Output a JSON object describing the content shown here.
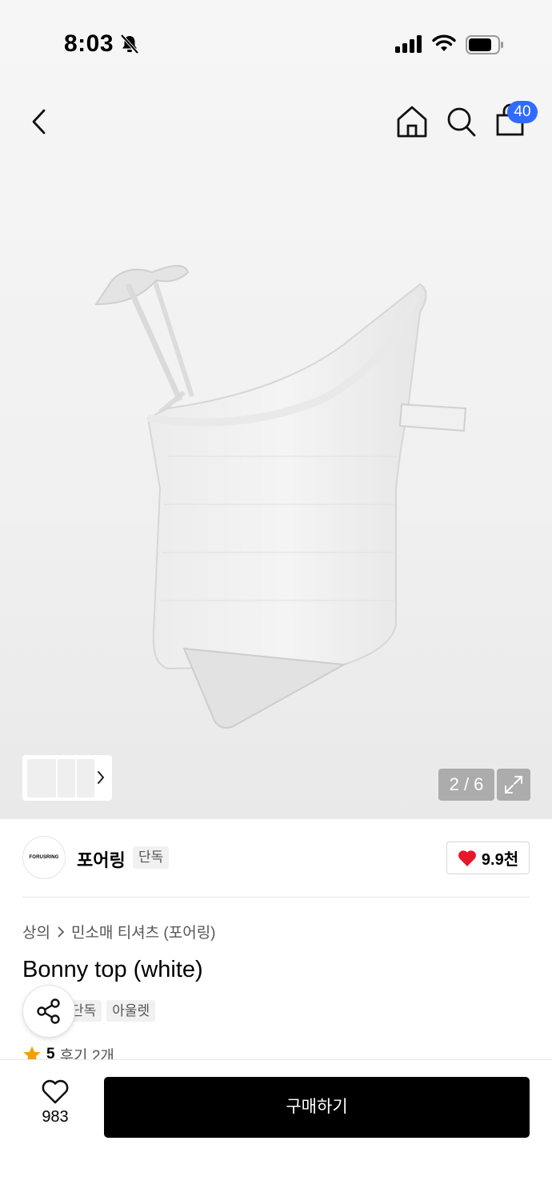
{
  "status_bar": {
    "time": "8:03"
  },
  "nav": {
    "cart_count": "40"
  },
  "gallery": {
    "counter": "2 / 6"
  },
  "brand": {
    "logo_text": "FORUSRING",
    "name": "포어링",
    "tag": "단독",
    "likes": "9.9천"
  },
  "breadcrumb": {
    "category": "상의",
    "subcategory": "민소매 티셔츠 (포어링)"
  },
  "product": {
    "title": "Bonny top (white)",
    "tags": [
      "단독",
      "아울렛"
    ]
  },
  "rating": {
    "score": "5",
    "reviews": "후기 2개"
  },
  "bottom": {
    "wish_count": "983",
    "buy_label": "구매하기"
  },
  "colors": {
    "accent_blue": "#2f6bff",
    "heart_red": "#e8172c",
    "star_orange": "#f2a007",
    "buy_black": "#000000"
  }
}
